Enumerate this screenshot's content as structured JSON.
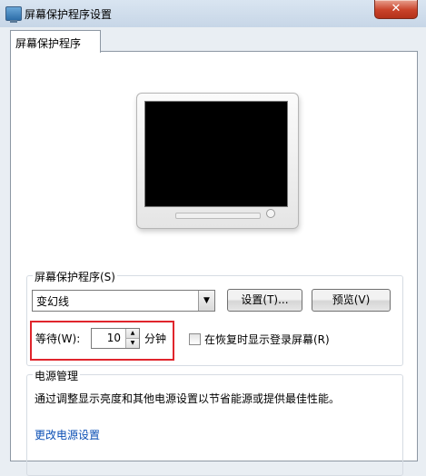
{
  "window": {
    "title": "屏幕保护程序设置",
    "close_label": "✕"
  },
  "tabs": [
    {
      "label": "屏幕保护程序"
    }
  ],
  "screensaver": {
    "group_label": "屏幕保护程序(S)",
    "selected": "变幻线",
    "settings_label": "设置(T)...",
    "preview_label": "预览(V)",
    "wait_label": "等待(W):",
    "wait_value": "10",
    "wait_unit": "分钟",
    "resume_label": "在恢复时显示登录屏幕(R)",
    "resume_checked": false
  },
  "power": {
    "group_label": "电源管理",
    "description": "通过调整显示亮度和其他电源设置以节省能源或提供最佳性能。",
    "link_label": "更改电源设置"
  },
  "colors": {
    "highlight": "#e0252c",
    "link": "#0b4fb5",
    "close": "#c9432a"
  }
}
